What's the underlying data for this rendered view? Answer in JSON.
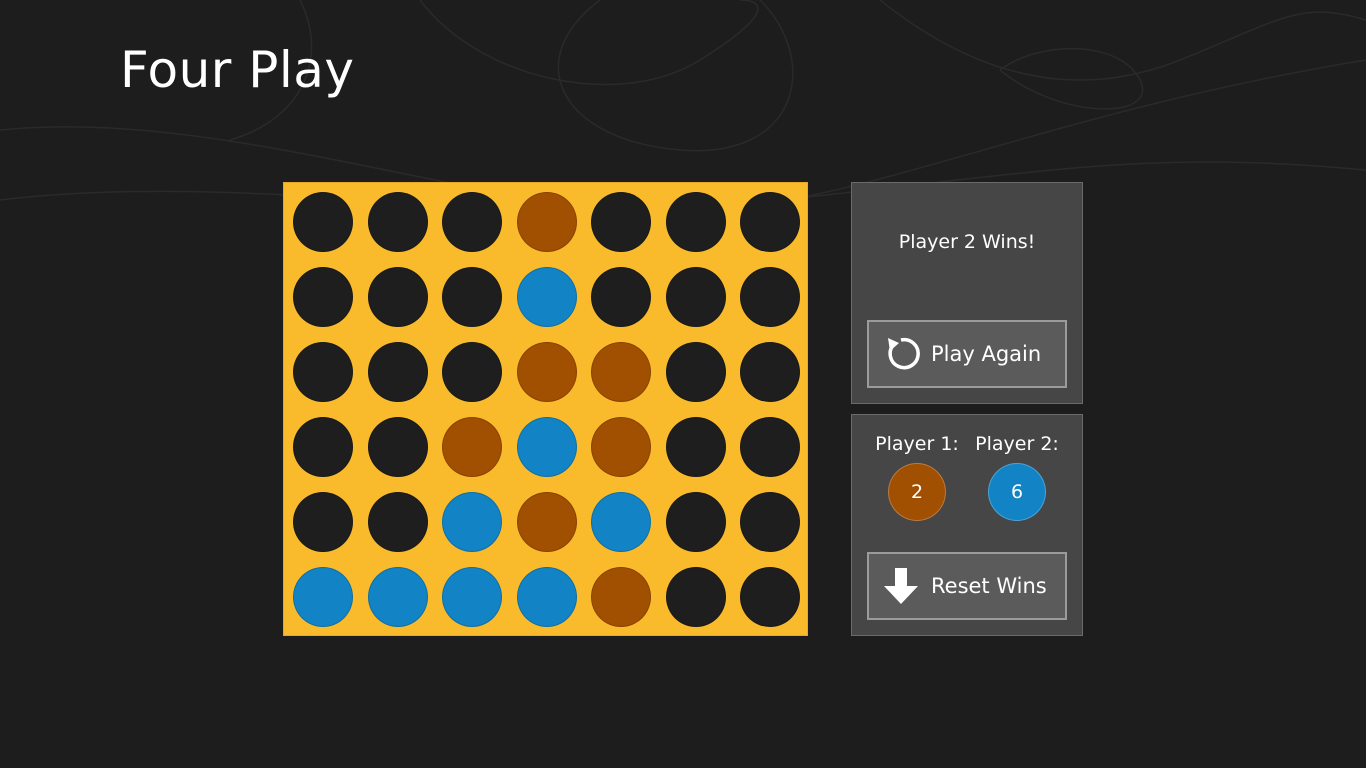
{
  "app": {
    "title": "Four Play"
  },
  "colors": {
    "background": "#1d1d1d",
    "board": "#f9bb2b",
    "empty": "#1e1e1e",
    "player1": "#a14f00",
    "player2": "#1283c4",
    "panel": "#464646",
    "button": "#5b5b5b"
  },
  "board": {
    "rows": 6,
    "cols": 7,
    "cells": [
      [
        "empty",
        "empty",
        "empty",
        "p1",
        "empty",
        "empty",
        "empty"
      ],
      [
        "empty",
        "empty",
        "empty",
        "p2",
        "empty",
        "empty",
        "empty"
      ],
      [
        "empty",
        "empty",
        "empty",
        "p1",
        "p1",
        "empty",
        "empty"
      ],
      [
        "empty",
        "empty",
        "p1",
        "p2",
        "p1",
        "empty",
        "empty"
      ],
      [
        "empty",
        "empty",
        "p2",
        "p1",
        "p2",
        "empty",
        "empty"
      ],
      [
        "p2",
        "p2",
        "p2",
        "p2",
        "p1",
        "empty",
        "empty"
      ]
    ]
  },
  "status": {
    "message": "Player 2 Wins!",
    "play_again_label": "Play Again",
    "play_again_icon": "refresh-icon"
  },
  "score": {
    "player1_label": "Player 1:",
    "player2_label": "Player 2:",
    "player1_wins": "2",
    "player2_wins": "6",
    "reset_label": "Reset Wins",
    "reset_icon": "arrow-down-icon"
  }
}
